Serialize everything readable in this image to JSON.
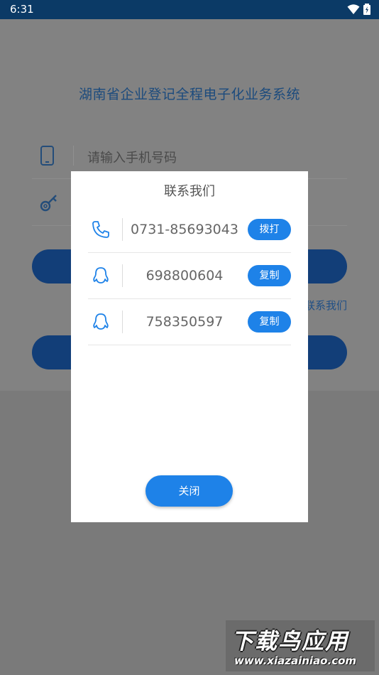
{
  "status_bar": {
    "time": "6:31"
  },
  "login": {
    "title": "湖南省企业登记全程电子化业务系统",
    "phone_placeholder": "请输入手机号码",
    "contact_link": "联系我们"
  },
  "dialog": {
    "title": "联系我们",
    "rows": [
      {
        "icon": "phone-icon",
        "value": "0731-85693043",
        "button": "拨打"
      },
      {
        "icon": "qq-icon",
        "value": "698800604",
        "button": "复制"
      },
      {
        "icon": "qq-icon",
        "value": "758350597",
        "button": "复制"
      }
    ],
    "close_label": "关闭"
  },
  "watermark": {
    "brand": "下载鸟应用",
    "url": "www.xiazainiao.com"
  },
  "colors": {
    "status_bar": "#0b3a66",
    "accent": "#1e82e8",
    "title_blue": "#1c4b7d"
  }
}
